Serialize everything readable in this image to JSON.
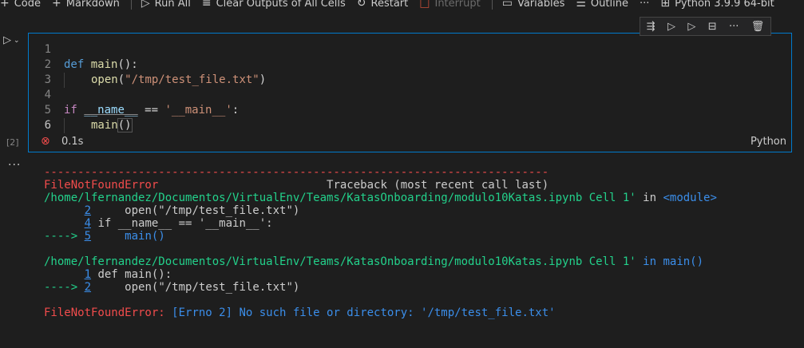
{
  "toolbar": {
    "code": "Code",
    "markdown": "Markdown",
    "run_all": "Run All",
    "clear_outputs": "Clear Outputs of All Cells",
    "restart": "Restart",
    "interrupt": "Interrupt",
    "variables": "Variables",
    "outline": "Outline",
    "more": "···",
    "kernel": "Python 3.9.9 64-bit"
  },
  "cell": {
    "exec_count": "[2]",
    "exec_time": "0.1s",
    "language": "Python",
    "lines": [
      {
        "num": "1"
      },
      {
        "num": "2",
        "text_kw": "def",
        "text_fn": "main",
        "text_rest": "():"
      },
      {
        "num": "3",
        "text_fn": "open",
        "text_str": "\"/tmp/test_file.txt\""
      },
      {
        "num": "4"
      },
      {
        "num": "5",
        "text_kw": "if",
        "text_dunder": "__name__",
        "text_op": "==",
        "text_str": "'__main__'",
        "text_rest": ":"
      },
      {
        "num": "6",
        "text_fn": "main",
        "text_rest": "()"
      }
    ]
  },
  "output": {
    "dashes": "---------------------------------------------------------------------------",
    "error_name": "FileNotFoundError",
    "traceback_header": "Traceback (most recent call last)",
    "frame1_path": "/home/lfernandez/Documentos/VirtualEnv/Teams/KatasOnboarding/modulo10Katas.ipynb Cell 1'",
    "frame1_in": "in",
    "frame1_where": "<module>",
    "frame1_lines": [
      {
        "arrow": "",
        "num": "2",
        "code": "     open(\"/tmp/test_file.txt\")"
      },
      {
        "arrow": "",
        "num": "4",
        "code": " if __name__ == '__main__':"
      },
      {
        "arrow": "---->",
        "num": "5",
        "code": "     main()"
      }
    ],
    "frame2_path": "/home/lfernandez/Documentos/VirtualEnv/Teams/KatasOnboarding/modulo10Katas.ipynb Cell 1'",
    "frame2_in": "in",
    "frame2_where": "main()",
    "frame2_lines": [
      {
        "arrow": "",
        "num": "1",
        "code": " def main():"
      },
      {
        "arrow": "---->",
        "num": "2",
        "code": "     open(\"/tmp/test_file.txt\")"
      }
    ],
    "final_error": "FileNotFoundError:",
    "final_message": "[Errno 2] No such file or directory: '/tmp/test_file.txt'"
  }
}
